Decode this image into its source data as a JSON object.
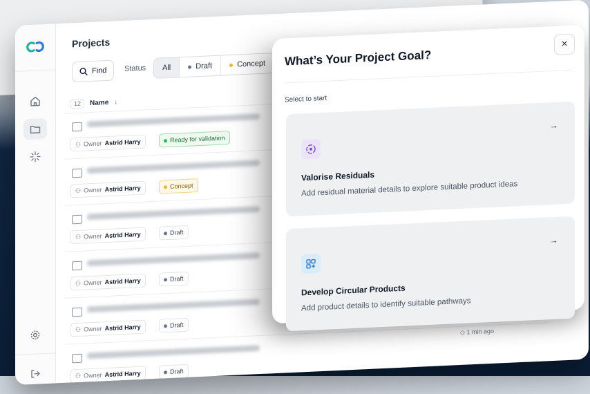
{
  "sidebar": {
    "icons": [
      "logo-icon",
      "home-icon",
      "folder-icon",
      "sparkle-icon",
      "settings-icon",
      "logout-icon"
    ]
  },
  "header": {
    "title": "Projects"
  },
  "toolbar": {
    "find_label": "Find",
    "status_label": "Status",
    "filters": [
      {
        "label": "All",
        "dot_color": ""
      },
      {
        "label": "Draft",
        "dot_color": "#6b7280"
      },
      {
        "label": "Concept",
        "dot_color": "#f2b233"
      }
    ]
  },
  "list": {
    "count": "12",
    "name_header": "Name",
    "sort_icon": "arrow-down-icon",
    "rows": [
      {
        "owner_label": "Owner",
        "owner": "Astrid Harry",
        "status": "Ready for validation",
        "status_color": "#2fb65a"
      },
      {
        "owner_label": "Owner",
        "owner": "Astrid Harry",
        "status": "Concept",
        "status_color": "#f2b233"
      },
      {
        "owner_label": "Owner",
        "owner": "Astrid Harry",
        "status": "Draft",
        "status_color": "#6b7280"
      },
      {
        "owner_label": "Owner",
        "owner": "Astrid Harry",
        "status": "Draft",
        "status_color": "#6b7280"
      },
      {
        "owner_label": "Owner",
        "owner": "Astrid Harry",
        "status": "Draft",
        "status_color": "#6b7280"
      },
      {
        "owner_label": "Owner",
        "owner": "Astrid Harry",
        "status": "Draft",
        "status_color": "#6b7280"
      }
    ],
    "last_updated": "1 min ago"
  },
  "modal": {
    "title": "What’s Your Project Goal?",
    "subtitle": "Select to start",
    "close_label": "×",
    "options": [
      {
        "title": "Valorise Residuals",
        "description": "Add residual material details to explore suitable product ideas",
        "icon": "recycle-icon",
        "icon_bg": "#ebe3f7",
        "icon_color": "#7b4fc4"
      },
      {
        "title": "Develop Circular Products",
        "description": "Add product details to identify suitable pathways",
        "icon": "grid-icon",
        "icon_bg": "#dcebf8",
        "icon_color": "#2f7ecb"
      }
    ]
  },
  "colors": {
    "accent_teal": "#20b3a4",
    "accent_blue": "#2f7ecb",
    "background_dark": "#0b1f38"
  }
}
